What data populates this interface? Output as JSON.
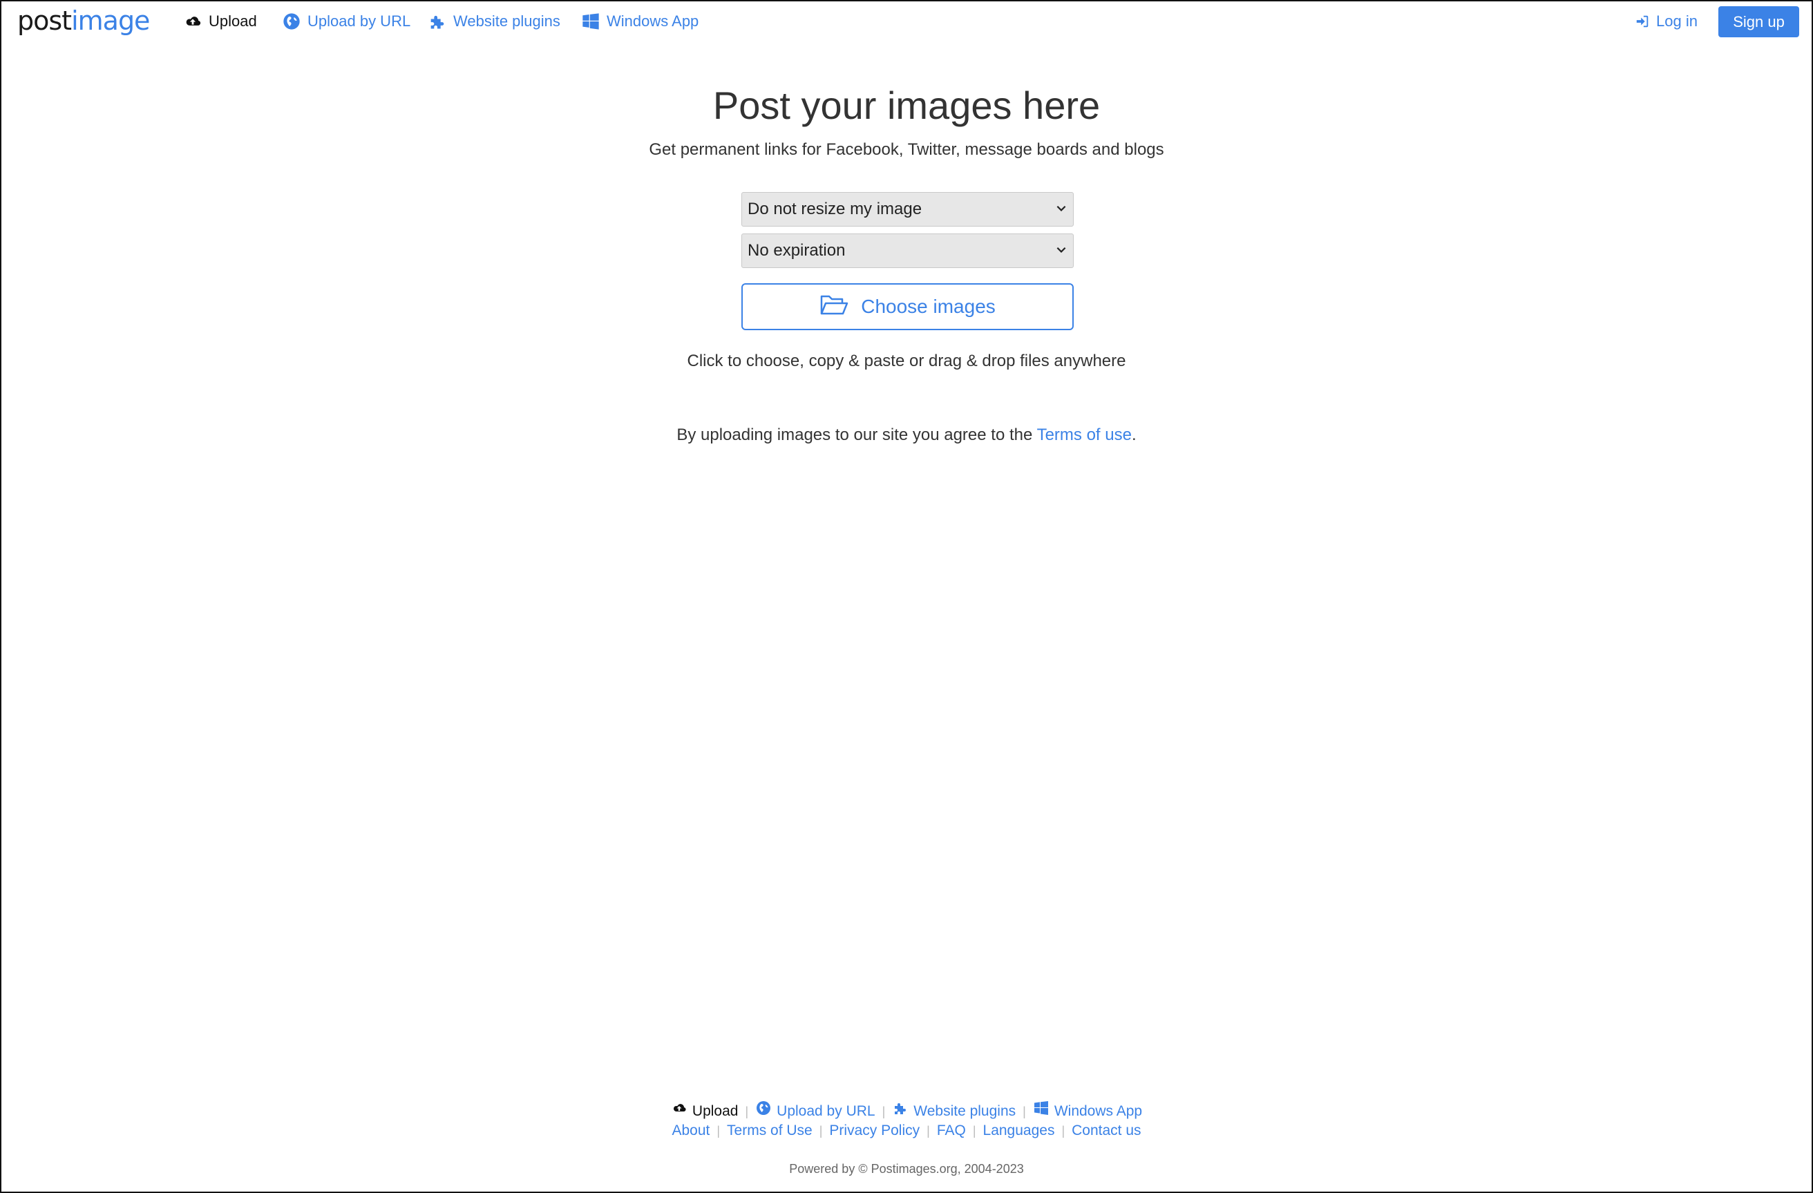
{
  "brand": {
    "logo_dark": "post",
    "logo_accent": "image"
  },
  "nav": {
    "upload": "Upload",
    "upload_by_url": "Upload by URL",
    "website_plugins": "Website plugins",
    "windows_app": "Windows App",
    "login": "Log in",
    "signup": "Sign up"
  },
  "main": {
    "title": "Post your images here",
    "subtitle": "Get permanent links for Facebook, Twitter, message boards and blogs",
    "resize_select": "Do not resize my image",
    "expiration_select": "No expiration",
    "choose_button": "Choose images",
    "hint": "Click to choose, copy & paste or drag & drop files anywhere",
    "terms_prefix": "By uploading images to our site you agree to the ",
    "terms_link": "Terms of use",
    "terms_suffix": "."
  },
  "footer": {
    "upload": "Upload",
    "upload_by_url": "Upload by URL",
    "website_plugins": "Website plugins",
    "windows_app": "Windows App",
    "about": "About",
    "terms": "Terms of Use",
    "privacy": "Privacy Policy",
    "faq": "FAQ",
    "languages": "Languages",
    "contact": "Contact us",
    "powered": "Powered by © Postimages.org, 2004-2023"
  },
  "colors": {
    "accent": "#3b82e6",
    "text": "#333333",
    "select_bg": "#e7e7e7"
  }
}
